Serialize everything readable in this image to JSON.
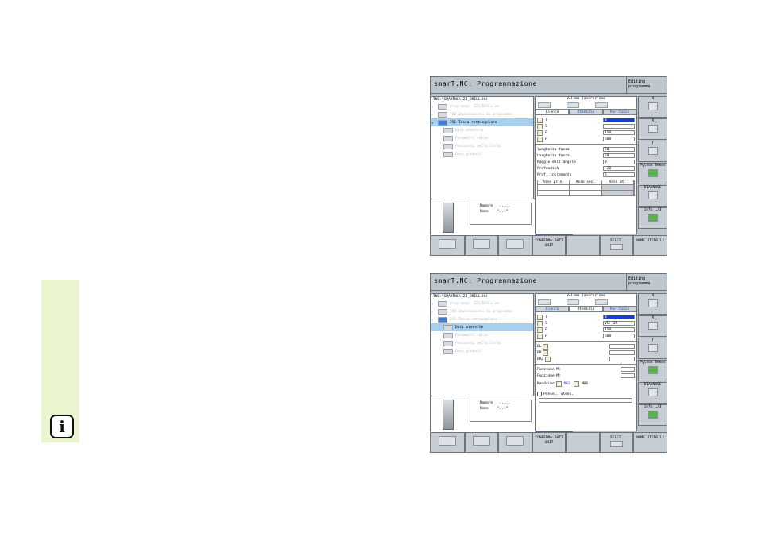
{
  "info_icon": {
    "symbol": "i"
  },
  "colors": {
    "sidebar_tab": "#e9f5cf",
    "selected_row": "#a8d0ee",
    "active_field": "#1b3fc4",
    "screen_bg": "#bcc4cc"
  },
  "screens": [
    {
      "title": "smarT.NC: Programmazione",
      "mode": [
        "Editing",
        "programma"
      ],
      "path": "TNC:\\SMARTNC\\123_DRILL.HU",
      "tree": [
        {
          "label": "Programma: 123_DRILL mm",
          "state": "faded"
        },
        {
          "label": "700 Impostazioni di programma",
          "state": "faded"
        },
        {
          "label": "251 Tasca rettangolare",
          "state": "selected"
        },
        {
          "label": "Dati utensile",
          "state": "faded"
        },
        {
          "label": "Parametri tasca",
          "state": "faded"
        },
        {
          "label": "Posizioni nella lista",
          "state": "faded"
        },
        {
          "label": "Dati globali",
          "state": "faded"
        }
      ],
      "tool_info": {
        "numero_label": "Numero",
        "numero_value": ".....",
        "nome_label": "Nome",
        "nome_value": "\"...\""
      },
      "form_title": "Volume lavorazione",
      "tabs": [
        "Elenco",
        "Utensile",
        "Par.tasca"
      ],
      "active_tab": 0,
      "fields": [
        {
          "icon": "T",
          "value": "0"
        },
        {
          "icon": "S",
          "value": ""
        },
        {
          "icon": "F",
          "value": "150"
        },
        {
          "icon": "F",
          "value": "500"
        }
      ],
      "params": [
        {
          "label": "lunghezza tasca",
          "value": "50"
        },
        {
          "label": "Larghezza tasca",
          "value": "20"
        },
        {
          "label": "Raggio dell'angolo",
          "value": "0"
        },
        {
          "label": "Profondità",
          "value": "-20"
        },
        {
          "label": "Prof. incremento",
          "value": "5"
        }
      ],
      "axes": [
        "Asse prin.",
        "Asse sec.",
        "Asse ut."
      ],
      "right_softkeys": [
        "M",
        "M",
        "T",
        "Python Demos",
        "DIAGNOSE",
        "Info 1/3"
      ],
      "bottom_softkeys": [
        "",
        "",
        "",
        "CONFERMA DATI UNIT",
        "",
        "SELEZ.",
        "NOME UTENSILE"
      ]
    },
    {
      "title": "smarT.NC: Programmazione",
      "mode": [
        "Editing",
        "programma"
      ],
      "path": "TNC:\\SMARTNC\\123_DRILL.HU",
      "tree": [
        {
          "label": "Programma: 123_DRILL mm",
          "state": "faded"
        },
        {
          "label": "700 Impostazioni di programma",
          "state": "faded"
        },
        {
          "label": "251 Tasca rettangolare",
          "state": "faded"
        },
        {
          "label": "Dati utensile",
          "state": "selected"
        },
        {
          "label": "Parametri tasca",
          "state": "faded"
        },
        {
          "label": "Posizioni nella lista",
          "state": "faded"
        },
        {
          "label": "Dati globali",
          "state": "faded"
        }
      ],
      "tool_info": {
        "numero_label": "Numero",
        "numero_value": ".....",
        "nome_label": "Nome",
        "nome_value": "\"...\""
      },
      "form_title": "Volume lavorazione",
      "tabs": [
        "Elenco",
        "Utensile",
        "Par.tasca"
      ],
      "active_tab": 1,
      "fields": [
        {
          "icon": "T",
          "value": "0"
        },
        {
          "icon": "S",
          "value": "VC: 25"
        },
        {
          "icon": "F",
          "value": "150"
        },
        {
          "icon": "F",
          "value": "500"
        }
      ],
      "offsets": [
        "DL",
        "DR",
        "DR2"
      ],
      "funzioni": [
        "Funzione M:",
        "Funzione M:"
      ],
      "mandrino": {
        "label": "Mandrino",
        "opt1": "M03",
        "opt2": "M04"
      },
      "presel": "Presel. utens.",
      "right_softkeys": [
        "M",
        "M",
        "T",
        "Python Demos",
        "DIAGNOSE",
        "Info 1/3"
      ],
      "bottom_softkeys": [
        "",
        "",
        "",
        "CONFERMA DATI UNIT",
        "",
        "SELEZ.",
        "NOME UTENSILE"
      ]
    }
  ]
}
